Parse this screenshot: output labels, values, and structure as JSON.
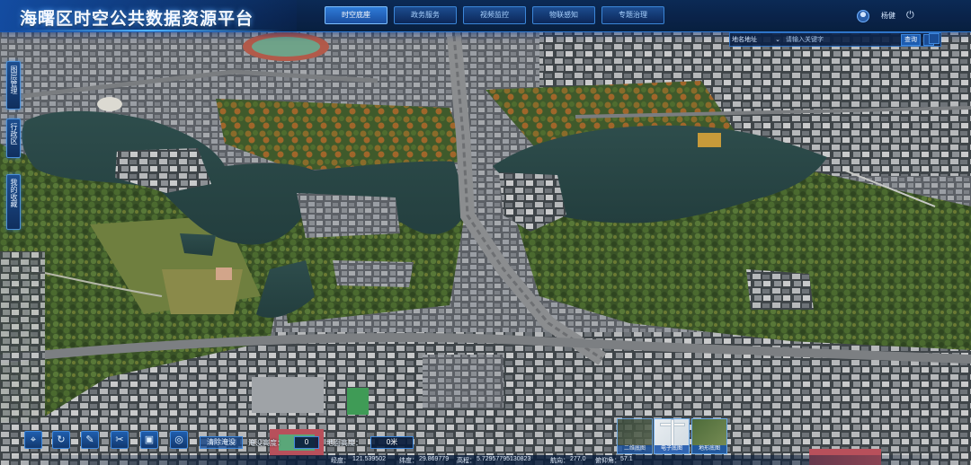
{
  "header": {
    "title": "海曙区时空公共数据资源平台",
    "nav": [
      "时空底座",
      "政务服务",
      "视频监控",
      "物联感知",
      "专题治理"
    ],
    "active_nav": "时空底座",
    "user_name": "杨健"
  },
  "search": {
    "type": "地名地址",
    "placeholder": "请输入关键字",
    "button": "查询"
  },
  "side_tabs": [
    "图层管理",
    "行政区",
    "我的收藏"
  ],
  "toolbar": {
    "clear_flood": "清除淹没",
    "flood_label": "淹没高度：",
    "flood_value": "0",
    "ground_label": "地面高度：",
    "ground_value": "0米"
  },
  "basemaps": [
    "二维底图",
    "电子底图",
    "地形底图"
  ],
  "status": {
    "lng_label": "经度：",
    "lng": "121.539502",
    "lat_label": "纬度：",
    "lat": "29.869779",
    "alt_label": "高程：",
    "alt": "5.72957795130823",
    "heading_label": "航向：",
    "heading": "277.0",
    "pitch_label": "俯仰角：",
    "pitch": "57.1"
  },
  "colors": {
    "header_bg": "#0a2248",
    "accent": "#2f7bd6",
    "water": "#2b4a48",
    "vegetation": "#3f5a2b"
  },
  "icons": [
    "location-icon",
    "refresh-icon",
    "pin-icon",
    "measure-icon",
    "capture-icon",
    "globe-icon",
    "power-icon",
    "search-icon",
    "layer-icon"
  ]
}
